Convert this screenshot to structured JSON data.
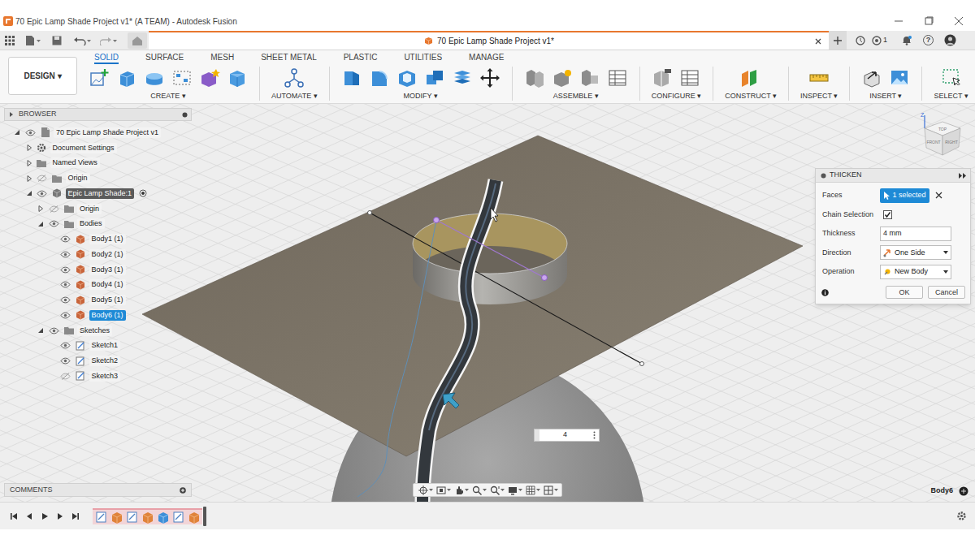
{
  "window": {
    "title": "70 Epic Lamp Shade Project v1* (A TEAM) - Autodesk Fusion"
  },
  "document_tab": {
    "label": "70 Epic Lamp Shade Project v1*",
    "selected": true
  },
  "header_right": {
    "jobs_count": "1",
    "help": "?"
  },
  "workspace": {
    "label": "DESIGN ▾"
  },
  "toolbar_tabs": [
    {
      "label": "SOLID",
      "selected": true
    },
    {
      "label": "SURFACE",
      "selected": false
    },
    {
      "label": "MESH",
      "selected": false
    },
    {
      "label": "SHEET METAL",
      "selected": false
    },
    {
      "label": "PLASTIC",
      "selected": false
    },
    {
      "label": "UTILITIES",
      "selected": false
    },
    {
      "label": "MANAGE",
      "selected": false
    }
  ],
  "toolbar_groups": [
    "CREATE ▾",
    "AUTOMATE ▾",
    "MODIFY ▾",
    "ASSEMBLE ▾",
    "CONFIGURE ▾",
    "CONSTRUCT ▾",
    "INSPECT ▾",
    "INSERT ▾",
    "SELECT ▾"
  ],
  "browser": {
    "title": "BROWSER",
    "items": [
      {
        "label": "70 Epic Lamp Shade Project v1",
        "depth": 0,
        "kind": "document",
        "expanded": true,
        "visible": true,
        "selected": false
      },
      {
        "label": "Document Settings",
        "depth": 1,
        "kind": "settings",
        "expanded": false,
        "selected": false
      },
      {
        "label": "Named Views",
        "depth": 1,
        "kind": "folder",
        "expanded": false,
        "selected": false
      },
      {
        "label": "Origin",
        "depth": 1,
        "kind": "folder",
        "expanded": false,
        "visible": false,
        "selected": false
      },
      {
        "label": "Epic Lamp Shade:1",
        "depth": 1,
        "kind": "component",
        "expanded": true,
        "visible": true,
        "active": true,
        "selected": false
      },
      {
        "label": "Origin",
        "depth": 2,
        "kind": "folder",
        "expanded": false,
        "visible": false,
        "selected": false
      },
      {
        "label": "Bodies",
        "depth": 2,
        "kind": "folder",
        "expanded": true,
        "visible": true,
        "selected": false
      },
      {
        "label": "Body1 (1)",
        "depth": 3,
        "kind": "body",
        "visible": true,
        "selected": false
      },
      {
        "label": "Body2 (1)",
        "depth": 3,
        "kind": "body",
        "visible": true,
        "selected": false
      },
      {
        "label": "Body3 (1)",
        "depth": 3,
        "kind": "body",
        "visible": true,
        "selected": false
      },
      {
        "label": "Body4 (1)",
        "depth": 3,
        "kind": "body",
        "visible": true,
        "selected": false
      },
      {
        "label": "Body5 (1)",
        "depth": 3,
        "kind": "body",
        "visible": true,
        "selected": false
      },
      {
        "label": "Body6 (1)",
        "depth": 3,
        "kind": "body",
        "visible": true,
        "selected": true
      },
      {
        "label": "Sketches",
        "depth": 2,
        "kind": "folder",
        "expanded": true,
        "visible": true,
        "selected": false
      },
      {
        "label": "Sketch1",
        "depth": 3,
        "kind": "sketch",
        "visible": true,
        "selected": false
      },
      {
        "label": "Sketch2",
        "depth": 3,
        "kind": "sketch",
        "visible": true,
        "selected": false
      },
      {
        "label": "Sketch3",
        "depth": 3,
        "kind": "sketch",
        "visible": false,
        "selected": false
      }
    ]
  },
  "comments": {
    "title": "COMMENTS"
  },
  "view_cube": {
    "top": "TOP",
    "front": "FRONT",
    "right": "RIGHT",
    "axis": "Z"
  },
  "thicken": {
    "title": "THICKEN",
    "rows": [
      {
        "kind": "selection",
        "label": "Faces",
        "value": "1 selected"
      },
      {
        "kind": "checkbox",
        "label": "Chain Selection",
        "checked": true
      },
      {
        "kind": "input",
        "label": "Thickness",
        "value": "4 mm"
      },
      {
        "kind": "dropdown",
        "label": "Direction",
        "value": "One Side"
      },
      {
        "kind": "dropdown",
        "label": "Operation",
        "value": "New Body"
      }
    ],
    "buttons": [
      "OK",
      "Cancel"
    ]
  },
  "dimension_input": {
    "value": "4"
  },
  "status": {
    "selection": "Body6"
  },
  "timeline": {
    "items": [
      {
        "kind": "sketch"
      },
      {
        "kind": "extrude"
      },
      {
        "kind": "sketch"
      },
      {
        "kind": "extrude"
      },
      {
        "kind": "surface"
      },
      {
        "kind": "sketch"
      },
      {
        "kind": "extrude"
      }
    ]
  }
}
